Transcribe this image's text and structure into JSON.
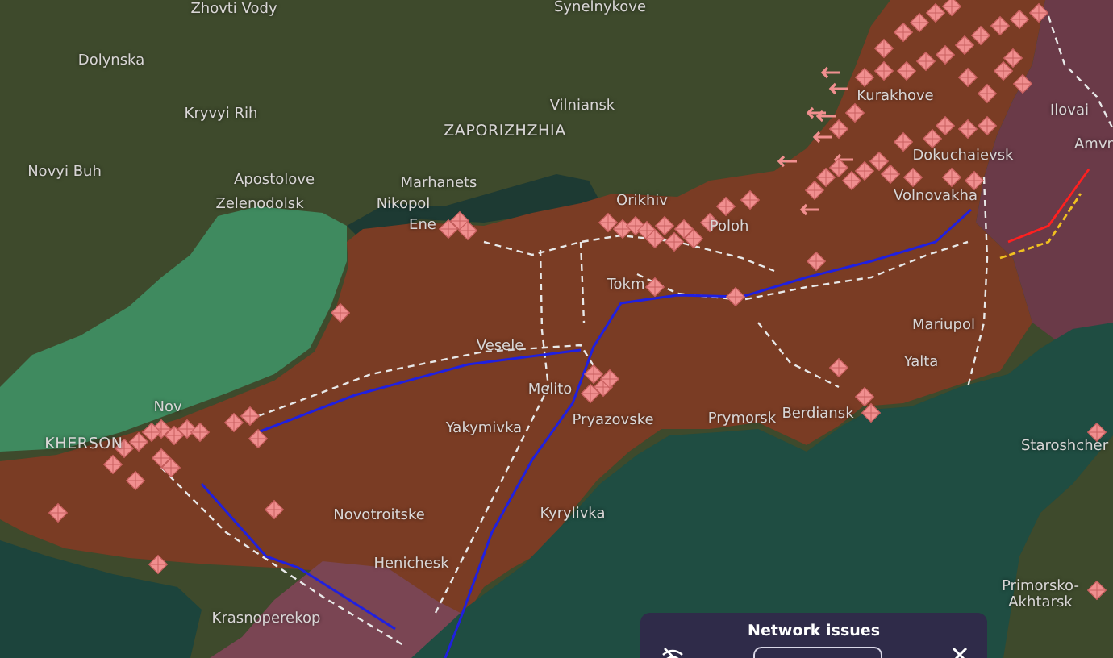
{
  "map": {
    "places": [
      {
        "name": "Zhovti Vody",
        "kind": "town"
      },
      {
        "name": "Synelnykove",
        "kind": "town"
      },
      {
        "name": "Dolynska",
        "kind": "town"
      },
      {
        "name": "Kryvyi Rih",
        "kind": "town"
      },
      {
        "name": "ZAPORIZHZHIA",
        "kind": "city"
      },
      {
        "name": "Vilniansk",
        "kind": "town"
      },
      {
        "name": "Novyi Buh",
        "kind": "town"
      },
      {
        "name": "Apostolove",
        "kind": "town"
      },
      {
        "name": "Marhanets",
        "kind": "town"
      },
      {
        "name": "Zelenodolsk",
        "kind": "town"
      },
      {
        "name": "Nikopol",
        "kind": "town"
      },
      {
        "name": "Ene",
        "kind": "town"
      },
      {
        "name": "Orikhiv",
        "kind": "town"
      },
      {
        "name": "Poloh",
        "kind": "town"
      },
      {
        "name": "Kurakhove",
        "kind": "town"
      },
      {
        "name": "Dokuchaievsk",
        "kind": "town"
      },
      {
        "name": "Volnovakha",
        "kind": "town"
      },
      {
        "name": "Ilovai",
        "kind": "town"
      },
      {
        "name": "Amvr",
        "kind": "town"
      },
      {
        "name": "Tokm",
        "kind": "town"
      },
      {
        "name": "Vesele",
        "kind": "town"
      },
      {
        "name": "Melito",
        "kind": "town"
      },
      {
        "name": "Yakymivka",
        "kind": "town"
      },
      {
        "name": "Pryazovske",
        "kind": "town"
      },
      {
        "name": "Prymorsk",
        "kind": "town"
      },
      {
        "name": "Berdiansk",
        "kind": "town"
      },
      {
        "name": "Mariupol",
        "kind": "town"
      },
      {
        "name": "Yalta",
        "kind": "town"
      },
      {
        "name": "KHERSON",
        "kind": "city"
      },
      {
        "name": "Nov",
        "kind": "town"
      },
      {
        "name": "Novotroitske",
        "kind": "town"
      },
      {
        "name": "Henichesk",
        "kind": "town"
      },
      {
        "name": "Kyrylivka",
        "kind": "town"
      },
      {
        "name": "Krasnoperekop",
        "kind": "town"
      },
      {
        "name": "Staroshcher",
        "kind": "town"
      },
      {
        "name": "Primorsko-Akhtarsk",
        "kind": "town"
      }
    ]
  },
  "toast": {
    "title": "Network issues"
  }
}
